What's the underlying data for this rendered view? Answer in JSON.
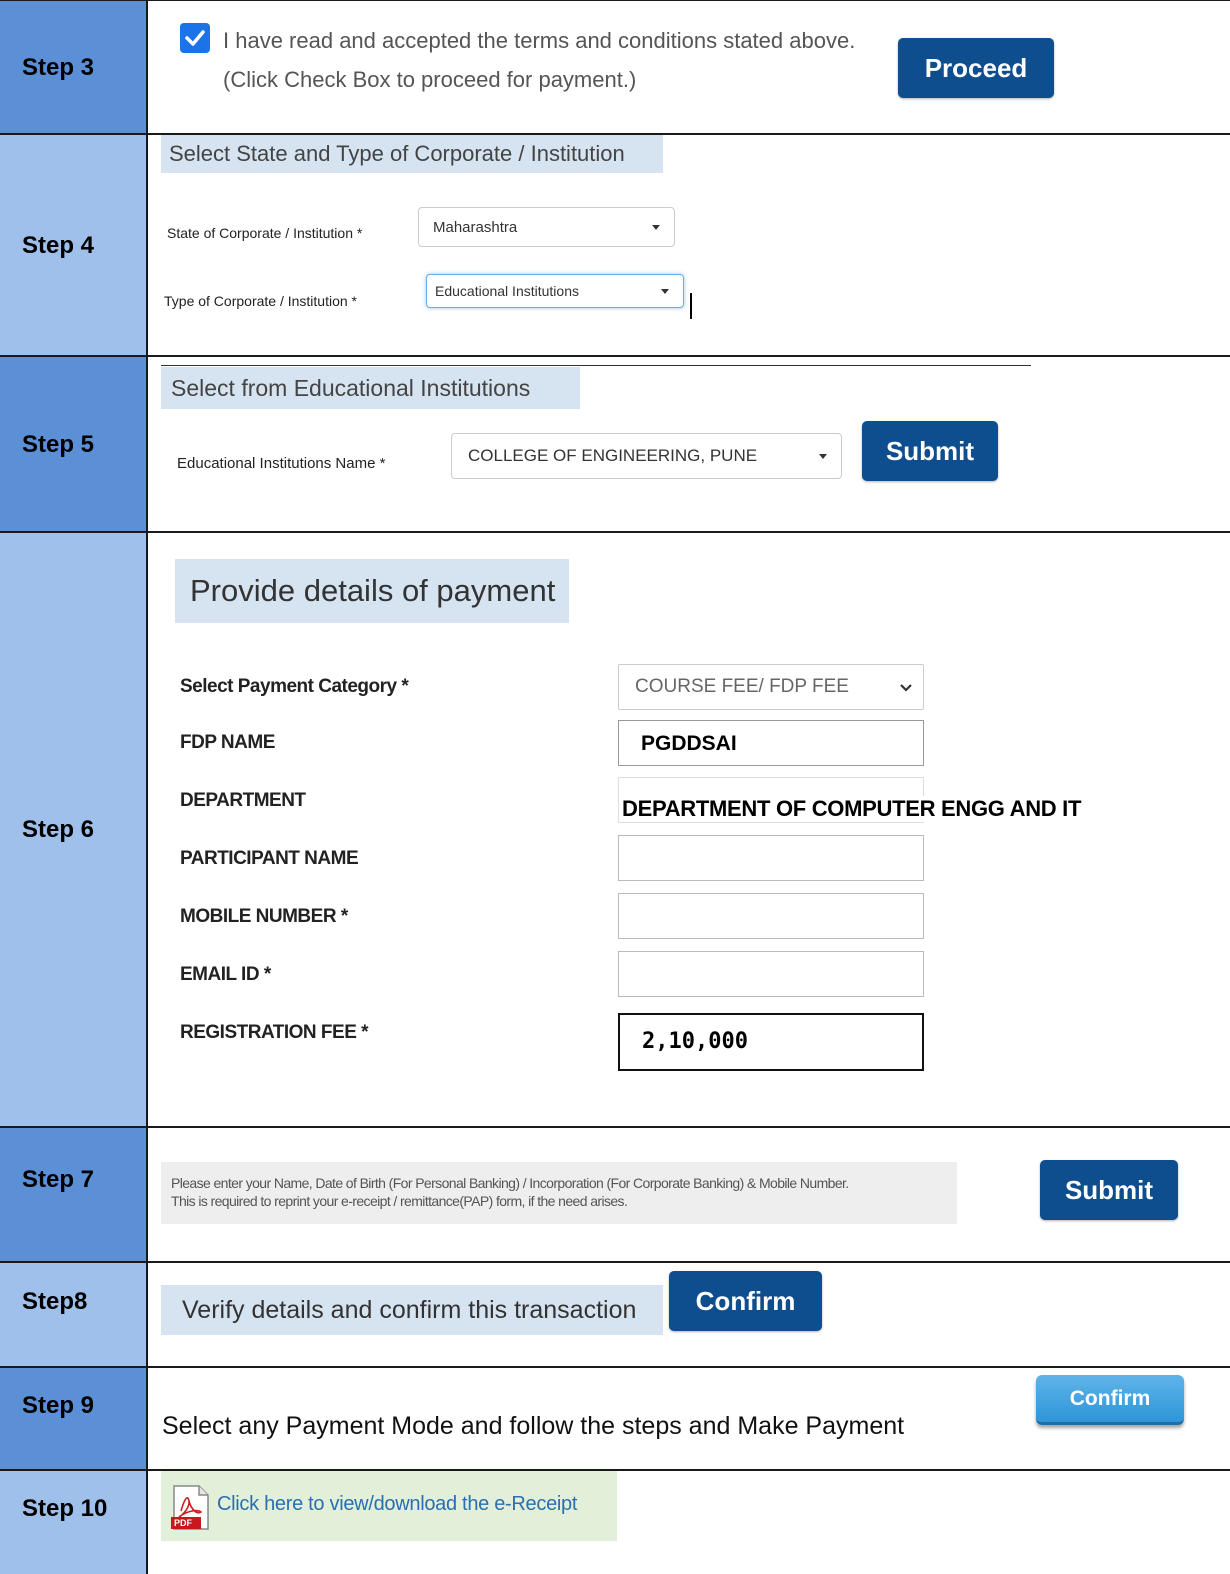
{
  "steps": {
    "s3": {
      "label": "Step 3",
      "terms_text": "I have read and accepted the terms and conditions stated above.",
      "terms_hint": "(Click Check Box to proceed for payment.)",
      "proceed_label": "Proceed",
      "checked": true
    },
    "s4": {
      "label": "Step 4",
      "heading": "Select State and Type of Corporate / Institution",
      "state_label": "State of Corporate / Institution *",
      "state_value": "Maharashtra",
      "type_label": "Type of Corporate / Institution *",
      "type_value": "Educational Institutions"
    },
    "s5": {
      "label": "Step 5",
      "heading": "Select from Educational Institutions",
      "inst_label": "Educational Institutions Name *",
      "inst_value": "COLLEGE OF ENGINEERING, PUNE",
      "submit_label": "Submit"
    },
    "s6": {
      "label": "Step 6",
      "heading": "Provide details of payment",
      "category_label": "Select Payment Category *",
      "category_value": "COURSE FEE/ FDP FEE",
      "fdp_label": "FDP NAME",
      "fdp_value": "PGDDSAI",
      "dept_label": "DEPARTMENT",
      "dept_value": "DEPARTMENT OF COMPUTER ENGG AND IT",
      "participant_label": "PARTICIPANT NAME",
      "mobile_label": "MOBILE NUMBER *",
      "email_label": "EMAIL ID *",
      "fee_label": "REGISTRATION FEE *",
      "fee_value": "2,10,000"
    },
    "s7": {
      "label": "Step 7",
      "note_line1": "Please enter your Name, Date of Birth (For Personal Banking) / Incorporation (For Corporate Banking)  & Mobile Number.",
      "note_line2": "This is required to reprint your e-receipt / remittance(PAP) form, if the need arises.",
      "submit_label": "Submit"
    },
    "s8": {
      "label": "Step8",
      "text": "Verify details and confirm this transaction",
      "confirm_label": "Confirm"
    },
    "s9": {
      "label": "Step 9",
      "text": "Select any Payment Mode and follow the steps and Make Payment",
      "confirm_label": "Confirm"
    },
    "s10": {
      "label": "Step 10",
      "link_text": "Click here to view/download the e-Receipt",
      "pdf_tag": "PDF"
    }
  }
}
